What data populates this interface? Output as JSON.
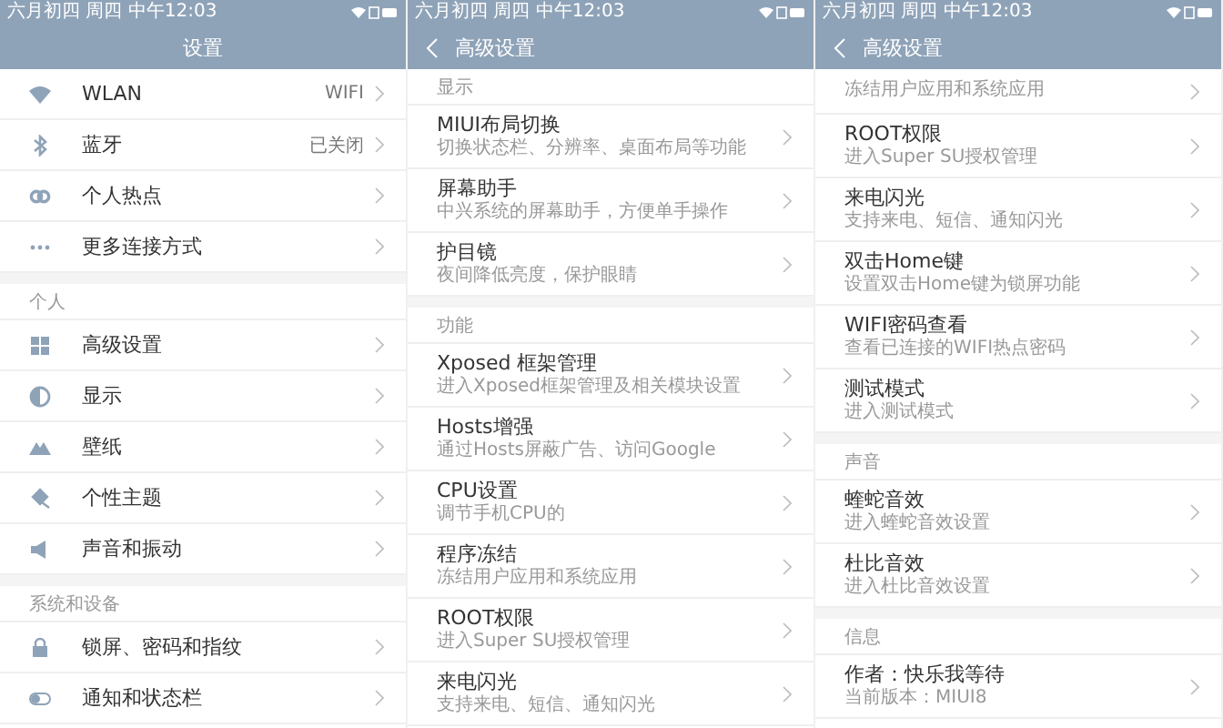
{
  "panels": [
    {
      "status_bar": {
        "time": "六月初四 周四 中午12:03"
      },
      "header": {
        "title": "设置"
      },
      "kind": "icons",
      "sections": [
        {
          "items": [
            {
              "title": "WLAN",
              "value": "WIFI"
            },
            {
              "title": "蓝牙",
              "value": "已关闭"
            },
            {
              "title": "个人热点"
            },
            {
              "title": "更多连接方式"
            }
          ]
        },
        {
          "heading": "个人",
          "items": [
            {
              "title": "高级设置"
            },
            {
              "title": "显示"
            },
            {
              "title": "壁纸"
            },
            {
              "title": "个性主题"
            },
            {
              "title": "声音和振动"
            }
          ]
        },
        {
          "heading": "系统和设备",
          "items": [
            {
              "title": "锁屏、密码和指纹"
            },
            {
              "title": "通知和状态栏"
            }
          ]
        }
      ]
    },
    {
      "status_bar": {
        "time": "六月初四 周四 中午12:03"
      },
      "header": {
        "title": "高级设置"
      },
      "kind": "details",
      "sections": [
        {
          "heading": "显示",
          "items": [
            {
              "title": "MIUI布局切换",
              "subtitle": "切换状态栏、分辨率、桌面布局等功能"
            },
            {
              "title": "屏幕助手",
              "subtitle": "中兴系统的屏幕助手，方便单手操作"
            },
            {
              "title": "护目镜",
              "subtitle": "夜间降低亮度，保护眼睛"
            }
          ]
        },
        {
          "heading": "功能",
          "items": [
            {
              "title": "Xposed 框架管理",
              "subtitle": "进入Xposed框架管理及相关模块设置"
            },
            {
              "title": "Hosts增强",
              "subtitle": "通过Hosts屏蔽广告、访问Google"
            },
            {
              "title": "CPU设置",
              "subtitle": "调节手机CPU的"
            },
            {
              "title": "程序冻结",
              "subtitle": "冻结用户应用和系统应用"
            },
            {
              "title": "ROOT权限",
              "subtitle": "进入Super SU授权管理"
            },
            {
              "title": "来电闪光",
              "subtitle": "支持来电、短信、通知闪光"
            }
          ]
        }
      ]
    },
    {
      "status_bar": {
        "time": "六月初四 周四 中午12:03"
      },
      "header": {
        "title": "高级设置"
      },
      "kind": "details",
      "sections": [
        {
          "items": [
            {
              "subtitle": "冻结用户应用和系统应用"
            },
            {
              "title": "ROOT权限",
              "subtitle": "进入Super SU授权管理"
            },
            {
              "title": "来电闪光",
              "subtitle": "支持来电、短信、通知闪光"
            },
            {
              "title": "双击Home键",
              "subtitle": "设置双击Home键为锁屏功能"
            },
            {
              "title": "WIFI密码查看",
              "subtitle": "查看已连接的WIFI热点密码"
            },
            {
              "title": "测试模式",
              "subtitle": "进入测试模式"
            }
          ]
        },
        {
          "heading": "声音",
          "items": [
            {
              "title": "蝰蛇音效",
              "subtitle": "进入蝰蛇音效设置"
            },
            {
              "title": "杜比音效",
              "subtitle": "进入杜比音效设置"
            }
          ]
        },
        {
          "heading": "信息",
          "items": [
            {
              "title": "作者：快乐我等待",
              "subtitle": "当前版本：MIUI8"
            }
          ]
        }
      ]
    }
  ]
}
